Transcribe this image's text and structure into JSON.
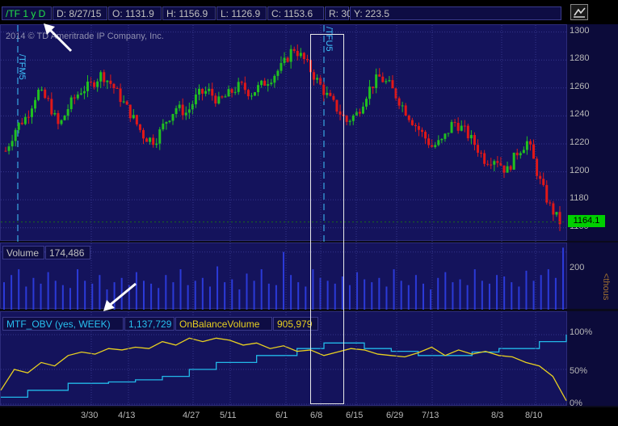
{
  "header": {
    "symbol": "/TF 1 y D",
    "date": "D: 8/27/15",
    "open": "O: 1131.9",
    "high": "H: 1156.9",
    "low": "L: 1126.9",
    "close": "C: 1153.6",
    "range": "R: 30",
    "yval": "Y: 223.5",
    "tool_icon": "trend-line-icon"
  },
  "price_panel": {
    "watermark": "2014 © TD Ameritrade IP Company, Inc.",
    "contract_labels": [
      "/TFM5",
      "/TFU5"
    ],
    "current_price": "1164.1",
    "current_price_color": "#00d000",
    "y_ticks": [
      "1300",
      "1280",
      "1260",
      "1240",
      "1220",
      "1200",
      "1180",
      "1160"
    ]
  },
  "volume_panel": {
    "label": "Volume",
    "value": "174,486",
    "y_ticks": [
      "200"
    ],
    "unit_label": "<thous"
  },
  "obv_panel": {
    "study_label": "MTF_OBV (yes, WEEK)",
    "study_value": "1,137,729",
    "obv_label": "OnBalanceVolume",
    "obv_value": "905,979",
    "y_ticks": [
      "100%",
      "50%",
      "0%"
    ],
    "colors": {
      "mtf": "#22b8e8",
      "obv": "#e8d020"
    }
  },
  "x_axis": {
    "labels": [
      "3/30",
      "4/13",
      "4/27",
      "5/11",
      "6/1",
      "6/8",
      "6/15",
      "6/29",
      "7/13",
      "8/3",
      "8/10"
    ]
  },
  "colors": {
    "up": "#20c020",
    "down": "#e01818",
    "volume": "#2b3ad8"
  },
  "chart_data": [
    {
      "type": "candlestick",
      "title": "/TF 1 y D",
      "ylim": [
        1150,
        1305
      ],
      "y_ticks": [
        1160,
        1180,
        1200,
        1220,
        1240,
        1260,
        1280,
        1300
      ],
      "x_tick_labels": [
        "3/30",
        "4/13",
        "4/27",
        "5/11",
        "6/1",
        "6/8",
        "6/15",
        "6/29",
        "7/13",
        "8/3",
        "8/10"
      ],
      "last_price": 1164.1,
      "close_path": [
        1215,
        1232,
        1240,
        1258,
        1250,
        1232,
        1248,
        1258,
        1262,
        1270,
        1262,
        1250,
        1238,
        1225,
        1222,
        1236,
        1246,
        1242,
        1255,
        1258,
        1250,
        1256,
        1262,
        1256,
        1262,
        1268,
        1276,
        1289,
        1280,
        1268,
        1256,
        1246,
        1236,
        1242,
        1258,
        1268,
        1262,
        1250,
        1238,
        1228,
        1218,
        1222,
        1236,
        1230,
        1220,
        1208,
        1210,
        1200,
        1214,
        1222,
        1196,
        1176,
        1164
      ]
    },
    {
      "type": "bar",
      "title": "Volume",
      "ylim": [
        0,
        230
      ],
      "y_ticks": [
        200
      ],
      "last_value": 174.486,
      "values": [
        95,
        120,
        140,
        80,
        110,
        90,
        130,
        100,
        85,
        75,
        140,
        100,
        90,
        120,
        70,
        95,
        110,
        85,
        130,
        100,
        90,
        75,
        120,
        95,
        140,
        85,
        100,
        110,
        80,
        150,
        95,
        105,
        70,
        125,
        100,
        140,
        90,
        85,
        200,
        120,
        95,
        80,
        140,
        110,
        100,
        90,
        115,
        85,
        130,
        105,
        95,
        110,
        80,
        140,
        100,
        85,
        120,
        90,
        70,
        110,
        130,
        95,
        105,
        85,
        140,
        100,
        90,
        120,
        115,
        95,
        80,
        135,
        100,
        120,
        140,
        110,
        215
      ]
    },
    {
      "type": "line",
      "title": "MTF_OBV (yes, WEEK) / OnBalanceVolume",
      "ylim": [
        0,
        100
      ],
      "y_ticks": [
        0,
        50,
        100
      ],
      "series": [
        {
          "name": "MTF_OBV (yes, WEEK)",
          "values": [
            10,
            10,
            20,
            20,
            20,
            30,
            30,
            30,
            32,
            32,
            35,
            35,
            40,
            40,
            50,
            50,
            60,
            60,
            60,
            70,
            70,
            70,
            80,
            80,
            88,
            88,
            88,
            80,
            80,
            76,
            76,
            70,
            70,
            70,
            70,
            75,
            75,
            80,
            80,
            80,
            90,
            90,
            100
          ]
        },
        {
          "name": "OnBalanceVolume",
          "values": [
            20,
            50,
            45,
            60,
            55,
            70,
            75,
            72,
            80,
            78,
            82,
            80,
            90,
            85,
            95,
            90,
            95,
            92,
            85,
            88,
            80,
            84,
            76,
            78,
            70,
            75,
            80,
            78,
            72,
            70,
            68,
            74,
            82,
            70,
            78,
            72,
            76,
            70,
            68,
            60,
            55,
            40,
            5
          ]
        }
      ]
    }
  ]
}
